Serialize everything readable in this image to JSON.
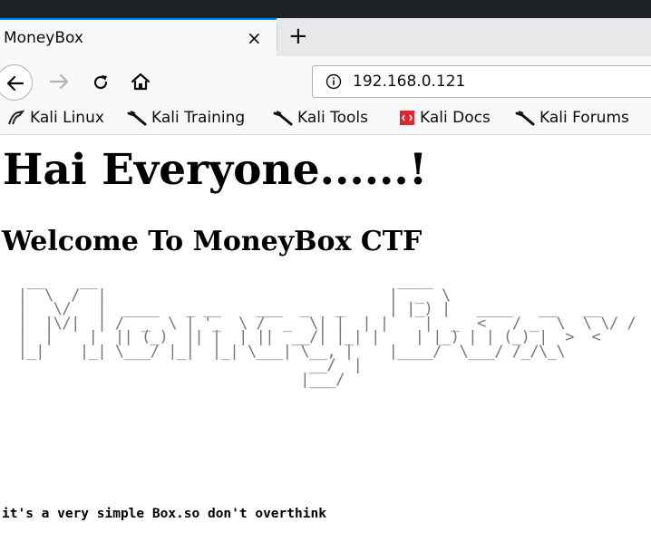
{
  "tab": {
    "title": "MoneyBox",
    "close_glyph": "×",
    "newtab_glyph": "+"
  },
  "nav": {
    "back": "back-arrow-icon",
    "forward": "forward-arrow-icon",
    "reload": "reload-icon",
    "home": "home-icon"
  },
  "urlbar": {
    "url": "192.168.0.121",
    "icon": "info-icon"
  },
  "bookmarks": [
    {
      "label": "Kali Linux",
      "icon": "kali-dragon-icon"
    },
    {
      "label": "Kali Training",
      "icon": "kali-dragon-icon"
    },
    {
      "label": "Kali Tools",
      "icon": "kali-dragon-icon"
    },
    {
      "label": "Kali Docs",
      "icon": "kali-docs-icon"
    },
    {
      "label": "Kali Forums",
      "icon": "kali-dragon-icon"
    }
  ],
  "page": {
    "heading": "Hai Everyone......!",
    "subheading": "Welcome To MoneyBox CTF",
    "ascii_art": "  __    __                                  ____\n |  \\  /  |                                |  _  \\\n |   \\/   |  ____   _ __    ___  _   _     | |_) |   ____   __   __\n |  |\\/|  | /  _  \\ | '_  \\ /  _  \\| |  | |    |  _  <   / _  \\  \\ \\/ /\n |  |    |  || (_)  || |  | ||  __/| |_| |    | |_) | | (_) |  >  <\n |_|    |_| \\___/ |_|  |_| \\___| \\__, |    |____/  \\___/ /_/\\_\\\n                                  __/  |\n                                 |___/",
    "note": "it's a very simple Box.so don't overthink"
  },
  "colors": {
    "accent": "#0a84ff",
    "titlebar": "#1f2227",
    "ascii": "#777777"
  }
}
